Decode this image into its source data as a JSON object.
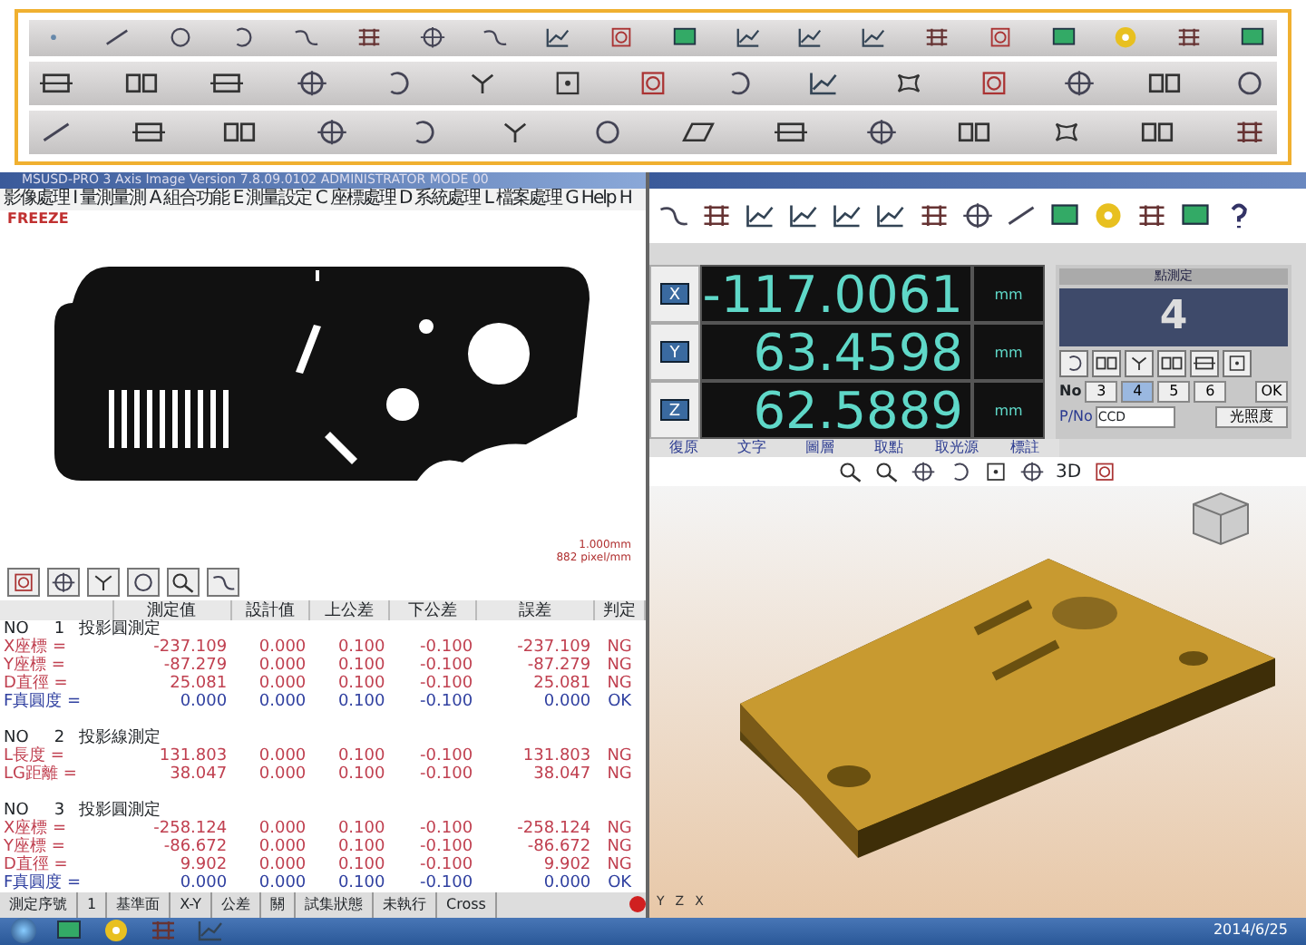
{
  "window": {
    "title": "MSUSD-PRO 3 Axis Image  Version 7.8.09.0102  ADMINISTRATOR MODE 00"
  },
  "menu": [
    "影像處理 I",
    "量測量測 A",
    "組合功能 E",
    "測量設定 C",
    "座標處理 D",
    "系統處理 L",
    "檔案處理 G",
    "Help H"
  ],
  "image_view": {
    "status": "FREEZE",
    "scale_lines": [
      "1.000mm",
      "882 pixel/mm"
    ]
  },
  "results": {
    "columns": [
      "",
      "測定值",
      "設計值",
      "上公差",
      "下公差",
      "誤差",
      "判定"
    ],
    "groups": [
      {
        "no": "NO",
        "index": "1",
        "title": "投影圓測定",
        "rows": [
          {
            "label": "X座標 =",
            "values": [
              "-237.109",
              "0.000",
              "0.100",
              "-0.100",
              "-237.109"
            ],
            "judgement": "NG",
            "pass": false
          },
          {
            "label": "Y座標 =",
            "values": [
              "-87.279",
              "0.000",
              "0.100",
              "-0.100",
              "-87.279"
            ],
            "judgement": "NG",
            "pass": false
          },
          {
            "label": "D直徑 =",
            "values": [
              "25.081",
              "0.000",
              "0.100",
              "-0.100",
              "25.081"
            ],
            "judgement": "NG",
            "pass": false
          },
          {
            "label": "F真圓度 =",
            "values": [
              "0.000",
              "0.000",
              "0.100",
              "-0.100",
              "0.000"
            ],
            "judgement": "OK",
            "pass": true
          }
        ]
      },
      {
        "no": "NO",
        "index": "2",
        "title": "投影線測定",
        "rows": [
          {
            "label": "L長度 =",
            "values": [
              "131.803",
              "0.000",
              "0.100",
              "-0.100",
              "131.803"
            ],
            "judgement": "NG",
            "pass": false
          },
          {
            "label": "LG距離 =",
            "values": [
              "38.047",
              "0.000",
              "0.100",
              "-0.100",
              "38.047"
            ],
            "judgement": "NG",
            "pass": false
          }
        ]
      },
      {
        "no": "NO",
        "index": "3",
        "title": "投影圓測定",
        "rows": [
          {
            "label": "X座標 =",
            "values": [
              "-258.124",
              "0.000",
              "0.100",
              "-0.100",
              "-258.124"
            ],
            "judgement": "NG",
            "pass": false
          },
          {
            "label": "Y座標 =",
            "values": [
              "-86.672",
              "0.000",
              "0.100",
              "-0.100",
              "-86.672"
            ],
            "judgement": "NG",
            "pass": false
          },
          {
            "label": "D直徑 =",
            "values": [
              "9.902",
              "0.000",
              "0.100",
              "-0.100",
              "9.902"
            ],
            "judgement": "NG",
            "pass": false
          },
          {
            "label": "F真圓度 =",
            "values": [
              "0.000",
              "0.000",
              "0.100",
              "-0.100",
              "0.000"
            ],
            "judgement": "OK",
            "pass": true
          }
        ]
      }
    ]
  },
  "status_bar": [
    "測定序號",
    "1",
    "基準面",
    "X-Y",
    "公差",
    "關",
    "試集狀態",
    "未執行",
    "Cross"
  ],
  "dro": {
    "axes": [
      {
        "axis": "X",
        "value": "-117.0061",
        "unit": "mm"
      },
      {
        "axis": "Y",
        "value": "63.4598",
        "unit": "mm"
      },
      {
        "axis": "Z",
        "value": "62.5889",
        "unit": "mm"
      }
    ]
  },
  "point_panel": {
    "title": "點測定",
    "count": "4",
    "no_label": "No",
    "numbers": [
      {
        "label": "3",
        "selected": false
      },
      {
        "label": "4",
        "selected": true
      },
      {
        "label": "5",
        "selected": false
      },
      {
        "label": "6",
        "selected": false
      }
    ],
    "ok": "OK",
    "pno_label": "P/No",
    "pno_value": "CCD",
    "button": "光照度"
  },
  "dro_tabs": [
    "復原",
    "文字",
    "圖層",
    "取點",
    "取光源",
    "標註"
  ],
  "view3d": {
    "mode": "3D",
    "axes": [
      "Y",
      "Z",
      "X"
    ]
  },
  "taskbar": {
    "date": "2014/6/25"
  }
}
